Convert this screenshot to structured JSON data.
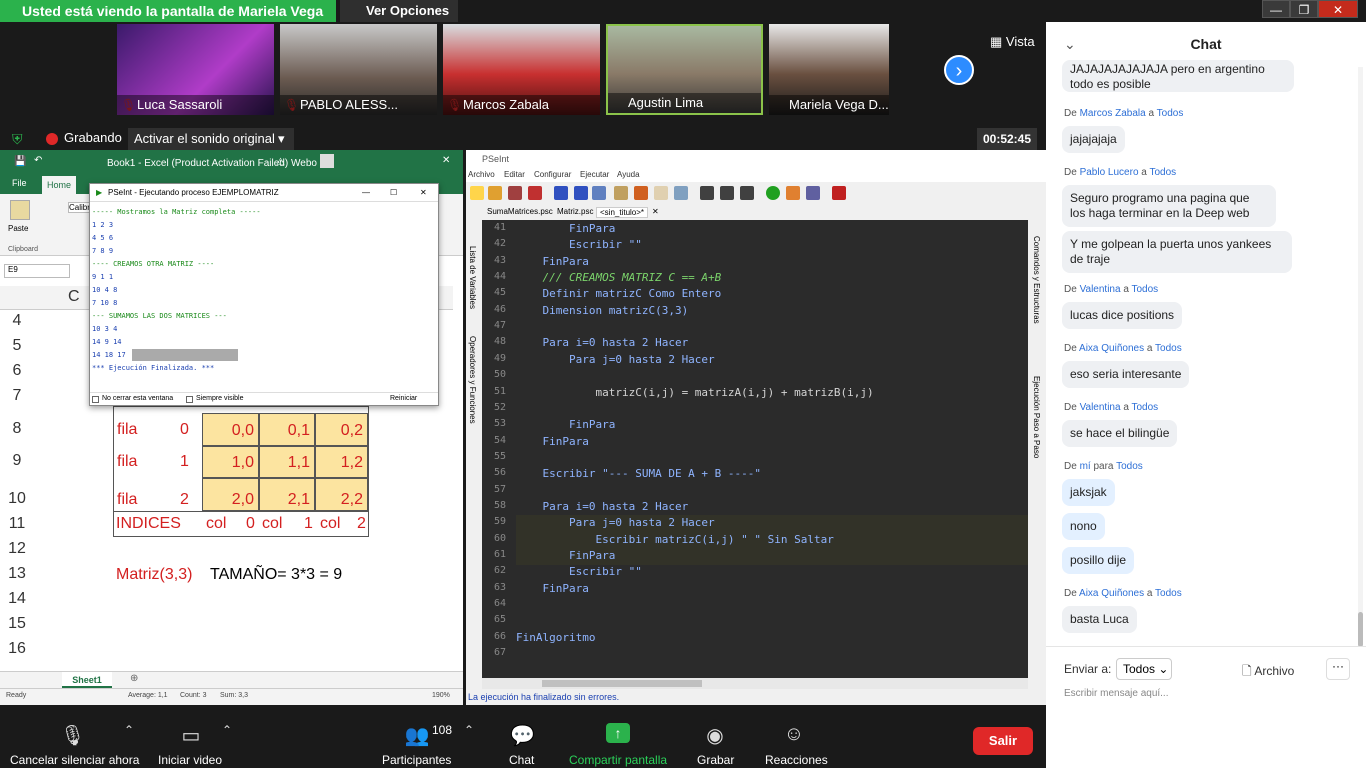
{
  "zoom": {
    "share_banner": "Usted está viendo la pantalla de Mariela Vega Devito",
    "view_options": "Ver Opciones",
    "view_label": "Vista",
    "recording": "Grabando",
    "sound_button": "Activar el sonido original",
    "timer": "00:52:45",
    "participants": [
      "Luca Sassaroli",
      "PABLO ALESS...",
      "Marcos Zabala",
      "Agustin Lima",
      "Mariela Vega D..."
    ],
    "bottom": {
      "mute": "Cancelar silenciar ahora",
      "video": "Iniciar video",
      "participants": "Participantes",
      "participants_count": "108",
      "chat": "Chat",
      "share": "Compartir pantalla",
      "record": "Grabar",
      "reactions": "Reacciones",
      "leave": "Salir"
    }
  },
  "excel": {
    "title": "Book1 - Excel (Product Activation Failed)",
    "user": "Webo",
    "tabs": {
      "file": "File",
      "home": "Home"
    },
    "paste": "Paste",
    "clipboard": "Clipboard",
    "font": "Calibr",
    "namebox": "E9",
    "col_c": "C",
    "rows": [
      "4",
      "5",
      "6",
      "7",
      "8",
      "9",
      "10",
      "11",
      "12",
      "13",
      "14",
      "15",
      "16"
    ],
    "fila": [
      "fila",
      "fila",
      "fila"
    ],
    "fila_n": [
      "0",
      "1",
      "2"
    ],
    "cells": [
      [
        "0,0",
        "0,1",
        "0,2"
      ],
      [
        "1,0",
        "1,1",
        "1,2"
      ],
      [
        "2,0",
        "2,1",
        "2,2"
      ]
    ],
    "indices": "INDICES",
    "col": [
      "col",
      "col",
      "col"
    ],
    "col_n": [
      "0",
      "1",
      "2"
    ],
    "matriz": "Matriz(3,3)",
    "tamano": "TAMAÑO= 3*3 = 9",
    "sheet": "Sheet1",
    "status": {
      "ready": "Ready",
      "average": "Average: 1,1",
      "count": "Count: 3",
      "sum": "Sum: 3,3",
      "zoom": "190%"
    }
  },
  "console": {
    "title": "PSeInt - Ejecutando proceso EJEMPLOMATRIZ",
    "lines": [
      "----- Mostramos la Matriz completa -----",
      "1 2 3",
      "4 5 6",
      "7 8 9",
      "---- CREAMOS OTRA MATRIZ ----",
      "9 1 1",
      "10 4 8",
      "7 10 8",
      "--- SUMAMOS LAS DOS MATRICES ---",
      "10 3 4",
      "14 9 14",
      "14 18 17",
      "*** Ejecución Finalizada. ***"
    ],
    "no_close": "No cerrar esta ventana",
    "always_visible": "Siempre visible",
    "restart": "Reiniciar"
  },
  "pseint": {
    "title": "PSeInt",
    "menu": [
      "Archivo",
      "Editar",
      "Configurar",
      "Ejecutar",
      "Ayuda"
    ],
    "tabs": [
      "SumaMatrices.psc",
      "Matriz.psc",
      "<sin_titulo>*"
    ],
    "left_labels": [
      "Lista de Variables",
      "Operadores y Funciones"
    ],
    "right_labels": [
      "Comandos y Estructuras",
      "Ejecución Paso a Paso"
    ],
    "status": "La ejecución ha finalizado sin errores.",
    "lines": [
      {
        "n": "41",
        "t": "        FinPara"
      },
      {
        "n": "42",
        "t": "        Escribir \"\""
      },
      {
        "n": "43",
        "t": "    FinPara"
      },
      {
        "n": "44",
        "t": "    /// CREAMOS MATRIZ C == A+B"
      },
      {
        "n": "45",
        "t": "    Definir matrizC Como Entero"
      },
      {
        "n": "46",
        "t": "    Dimension matrizC(3,3)"
      },
      {
        "n": "47",
        "t": ""
      },
      {
        "n": "48",
        "t": "    Para i=0 hasta 2 Hacer"
      },
      {
        "n": "49",
        "t": "        Para j=0 hasta 2 Hacer"
      },
      {
        "n": "50",
        "t": ""
      },
      {
        "n": "51",
        "t": "            matrizC(i,j) = matrizA(i,j) + matrizB(i,j)"
      },
      {
        "n": "52",
        "t": ""
      },
      {
        "n": "53",
        "t": "        FinPara"
      },
      {
        "n": "54",
        "t": "    FinPara"
      },
      {
        "n": "55",
        "t": ""
      },
      {
        "n": "56",
        "t": "    Escribir \"--- SUMA DE A + B ----\""
      },
      {
        "n": "57",
        "t": ""
      },
      {
        "n": "58",
        "t": "    Para i=0 hasta 2 Hacer"
      },
      {
        "n": "59",
        "t": "        Para j=0 hasta 2 Hacer"
      },
      {
        "n": "60",
        "t": "            Escribir matrizC(i,j) \" \" Sin Saltar"
      },
      {
        "n": "61",
        "t": "        FinPara"
      },
      {
        "n": "62",
        "t": "        Escribir \"\""
      },
      {
        "n": "63",
        "t": "    FinPara"
      },
      {
        "n": "64",
        "t": ""
      },
      {
        "n": "65",
        "t": ""
      },
      {
        "n": "66",
        "t": "FinAlgoritmo"
      },
      {
        "n": "67",
        "t": ""
      }
    ]
  },
  "chat": {
    "title": "Chat",
    "messages": [
      {
        "from": "",
        "to": "",
        "text": "JAJAJAJAJAJAJA pero en argentino todo es posible"
      },
      {
        "from": "Marcos Zabala",
        "to": "Todos",
        "text": "jajajajaja"
      },
      {
        "from": "Pablo Lucero",
        "to": "Todos",
        "text": "Seguro programo una pagina que los haga terminar en la Deep web"
      },
      {
        "from": "",
        "to": "",
        "text": "Y me golpean la puerta unos yankees de traje"
      },
      {
        "from": "Valentina",
        "to": "Todos",
        "text": "lucas dice positions"
      },
      {
        "from": "Aixa Quiñones",
        "to": "Todos",
        "text": "eso seria interesante"
      },
      {
        "from": "Valentina",
        "to": "Todos",
        "text": "se hace el bilingüe"
      },
      {
        "from": "mí",
        "to": "Todos",
        "text": "jaksjak"
      },
      {
        "from": "",
        "to": "",
        "text": "nono"
      },
      {
        "from": "",
        "to": "",
        "text": "posillo dije"
      },
      {
        "from": "Aixa Quiñones",
        "to": "Todos",
        "text": "basta Luca"
      }
    ],
    "de": "De",
    "a": "a",
    "para": "para",
    "send_to": "Enviar a:",
    "send_to_value": "Todos",
    "file": "Archivo",
    "more": "···",
    "placeholder": "Escribir mensaje aquí..."
  }
}
